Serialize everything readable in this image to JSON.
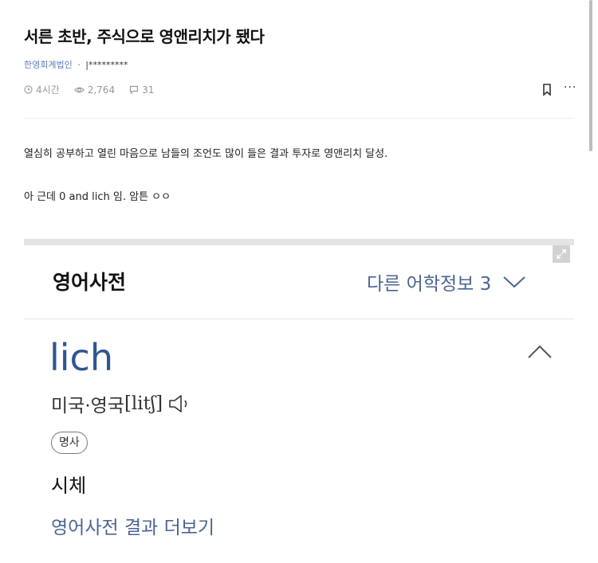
{
  "post": {
    "title": "서른 초반, 주식으로 영앤리치가 됐다",
    "company": "한영회계법인",
    "separator": "·",
    "author": "|*********",
    "time": "4시간",
    "views": "2,764",
    "comments": "31",
    "more": "···",
    "body_lines": [
      "열심히 공부하고 열린 마음으로 남들의 조언도 많이 들은 결과 투자로 영앤리치 달성.",
      "아 근데 0 and lich 임. 암튼 ㅇㅇ"
    ]
  },
  "dictionary": {
    "title": "영어사전",
    "other_info": "다른 어학정보 3",
    "word": "lich",
    "pron_label": "미국·영국",
    "pronunciation": "[litʃ]",
    "pos": "명사",
    "meaning": "시체",
    "more_link": "영어사전 결과 더보기"
  },
  "icons": {
    "time": "clock-icon",
    "views": "eye-icon",
    "comments": "speech-bubble-icon",
    "bookmark": "bookmark-icon",
    "expand": "expand-icon",
    "dropdown": "chevron-down-icon",
    "collapse": "chevron-up-icon",
    "audio": "speaker-icon"
  },
  "colors": {
    "company": "#5b7fb8",
    "dict_accent": "#4a6591",
    "word": "#2e5690",
    "meta": "#999999"
  }
}
